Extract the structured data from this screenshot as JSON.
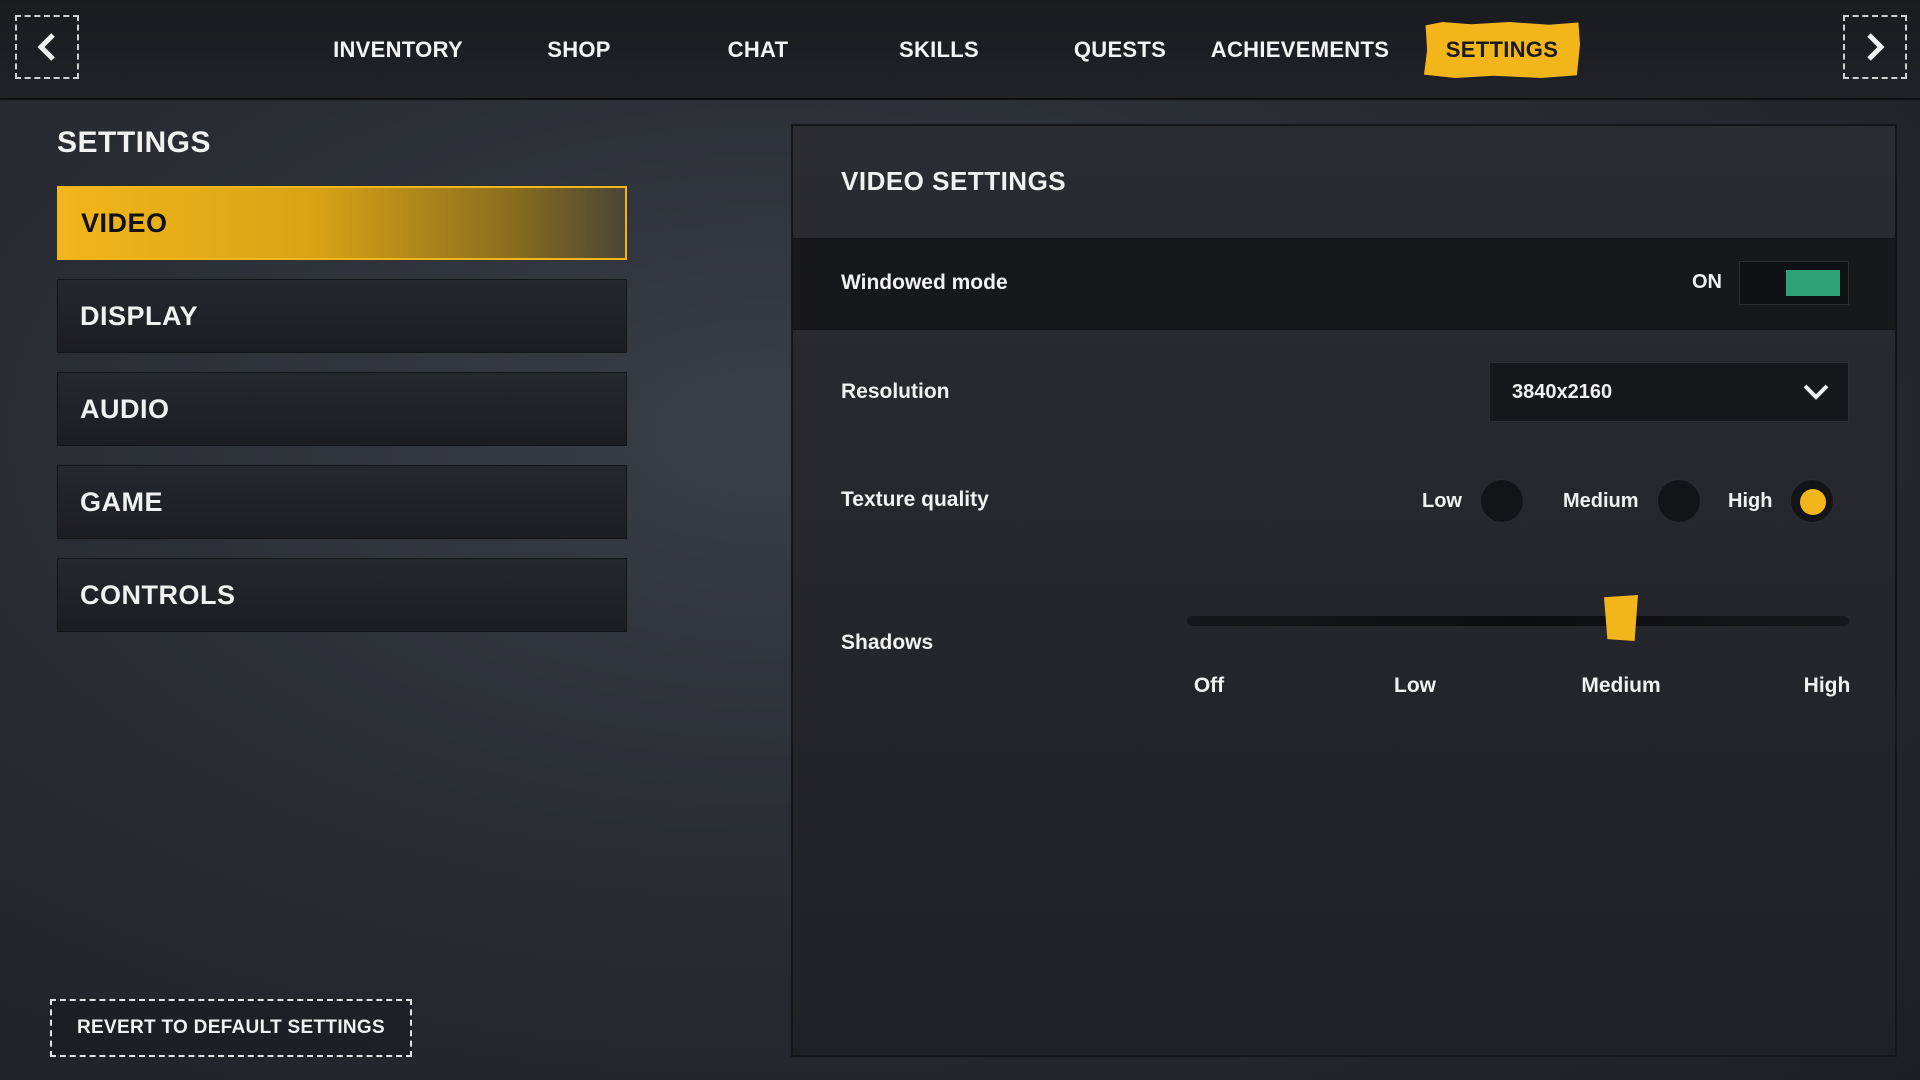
{
  "nav": {
    "tabs": [
      {
        "label": "INVENTORY",
        "active": false
      },
      {
        "label": "SHOP",
        "active": false
      },
      {
        "label": "CHAT",
        "active": false
      },
      {
        "label": "SKILLS",
        "active": false
      },
      {
        "label": "QUESTS",
        "active": false
      },
      {
        "label": "ACHIEVEMENTS",
        "active": false
      },
      {
        "label": "SETTINGS",
        "active": true
      }
    ],
    "prev_icon": "chevron-left-icon",
    "next_icon": "chevron-right-icon"
  },
  "sidebar": {
    "title": "SETTINGS",
    "items": [
      {
        "label": "VIDEO",
        "active": true
      },
      {
        "label": "DISPLAY",
        "active": false
      },
      {
        "label": "AUDIO",
        "active": false
      },
      {
        "label": "GAME",
        "active": false
      },
      {
        "label": "CONTROLS",
        "active": false
      }
    ],
    "revert_label": "REVERT TO DEFAULT SETTINGS"
  },
  "video": {
    "title": "VIDEO SETTINGS",
    "windowed_mode": {
      "label": "Windowed mode",
      "state_text": "ON",
      "on": true
    },
    "resolution": {
      "label": "Resolution",
      "value": "3840x2160"
    },
    "texture_quality": {
      "label": "Texture quality",
      "options": [
        "Low",
        "Medium",
        "High"
      ],
      "selected": "High"
    },
    "shadows": {
      "label": "Shadows",
      "levels": [
        "Off",
        "Low",
        "Medium",
        "High"
      ],
      "selected_index": 2
    }
  },
  "colors": {
    "accent": "#f2b61a",
    "toggle_on": "#2ea37a",
    "panel_dark": "#17181c"
  }
}
